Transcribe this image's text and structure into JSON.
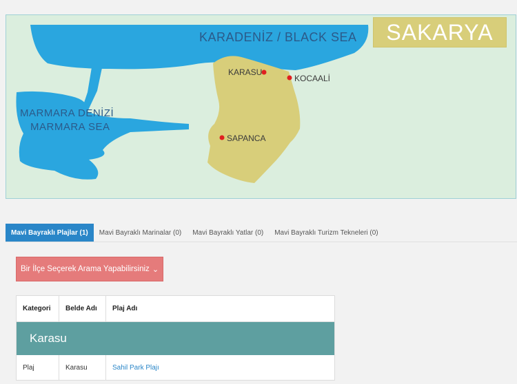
{
  "map": {
    "title": "SAKARYA",
    "sea_black": "KARADENİZ / BLACK SEA",
    "sea_marmara_tr": "MARMARA DENİZİ",
    "sea_marmara_en": "MARMARA SEA",
    "cities": [
      "KARASU",
      "KOCAALİ",
      "SAPANCA"
    ],
    "colors": {
      "land": "#dbeede",
      "sea": "#2aa6df",
      "province": "#d8ce7a",
      "city_dot": "#e02020"
    }
  },
  "tabs": [
    {
      "label": "Mavi Bayraklı Plajlar (1)",
      "active": true
    },
    {
      "label": "Mavi Bayraklı Marinalar (0)",
      "active": false
    },
    {
      "label": "Mavi Bayraklı Yatlar (0)",
      "active": false
    },
    {
      "label": "Mavi Bayraklı Turizm Tekneleri (0)",
      "active": false
    }
  ],
  "district_select": {
    "label": "Bir İlçe Seçerek Arama Yapabilirsiniz",
    "icon": "chevron-down-icon"
  },
  "table": {
    "headers": [
      "Kategori",
      "Belde Adı",
      "Plaj Adı"
    ],
    "group": "Karasu",
    "rows": [
      {
        "category": "Plaj",
        "town": "Karasu",
        "beach": "Sahil Park Plajı"
      }
    ]
  }
}
